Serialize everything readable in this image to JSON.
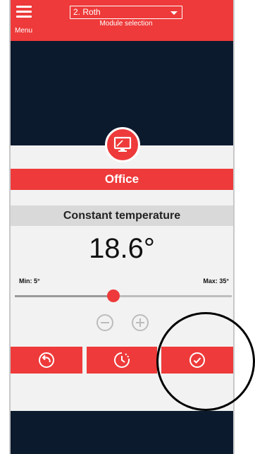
{
  "header": {
    "menu_label": "Menu",
    "module_value": "2. Roth",
    "module_caption": "Module selection"
  },
  "room": {
    "icon": "monitor-icon",
    "name": "Office"
  },
  "mode": {
    "label": "Constant temperature"
  },
  "temperature": {
    "value": "18.6°",
    "min_label": "Min: 5°",
    "max_label": "Max: 35°",
    "min": 5,
    "max": 35,
    "current": 18.6
  },
  "actions": {
    "back_icon": "undo-arrow-icon",
    "schedule_icon": "clock-timer-icon",
    "confirm_icon": "checkmark-circle-icon"
  },
  "colors": {
    "accent": "#ee3a3a",
    "background": "#0c1a2e",
    "panel": "#f2f2f2"
  }
}
